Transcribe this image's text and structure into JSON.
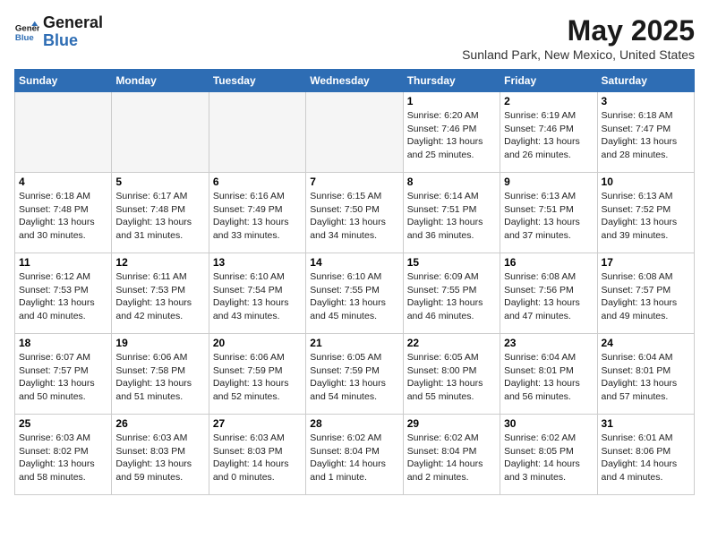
{
  "header": {
    "logo_line1": "General",
    "logo_line2": "Blue",
    "month_title": "May 2025",
    "location": "Sunland Park, New Mexico, United States"
  },
  "weekdays": [
    "Sunday",
    "Monday",
    "Tuesday",
    "Wednesday",
    "Thursday",
    "Friday",
    "Saturday"
  ],
  "weeks": [
    [
      {
        "day": "",
        "info": ""
      },
      {
        "day": "",
        "info": ""
      },
      {
        "day": "",
        "info": ""
      },
      {
        "day": "",
        "info": ""
      },
      {
        "day": "1",
        "info": "Sunrise: 6:20 AM\nSunset: 7:46 PM\nDaylight: 13 hours\nand 25 minutes."
      },
      {
        "day": "2",
        "info": "Sunrise: 6:19 AM\nSunset: 7:46 PM\nDaylight: 13 hours\nand 26 minutes."
      },
      {
        "day": "3",
        "info": "Sunrise: 6:18 AM\nSunset: 7:47 PM\nDaylight: 13 hours\nand 28 minutes."
      }
    ],
    [
      {
        "day": "4",
        "info": "Sunrise: 6:18 AM\nSunset: 7:48 PM\nDaylight: 13 hours\nand 30 minutes."
      },
      {
        "day": "5",
        "info": "Sunrise: 6:17 AM\nSunset: 7:48 PM\nDaylight: 13 hours\nand 31 minutes."
      },
      {
        "day": "6",
        "info": "Sunrise: 6:16 AM\nSunset: 7:49 PM\nDaylight: 13 hours\nand 33 minutes."
      },
      {
        "day": "7",
        "info": "Sunrise: 6:15 AM\nSunset: 7:50 PM\nDaylight: 13 hours\nand 34 minutes."
      },
      {
        "day": "8",
        "info": "Sunrise: 6:14 AM\nSunset: 7:51 PM\nDaylight: 13 hours\nand 36 minutes."
      },
      {
        "day": "9",
        "info": "Sunrise: 6:13 AM\nSunset: 7:51 PM\nDaylight: 13 hours\nand 37 minutes."
      },
      {
        "day": "10",
        "info": "Sunrise: 6:13 AM\nSunset: 7:52 PM\nDaylight: 13 hours\nand 39 minutes."
      }
    ],
    [
      {
        "day": "11",
        "info": "Sunrise: 6:12 AM\nSunset: 7:53 PM\nDaylight: 13 hours\nand 40 minutes."
      },
      {
        "day": "12",
        "info": "Sunrise: 6:11 AM\nSunset: 7:53 PM\nDaylight: 13 hours\nand 42 minutes."
      },
      {
        "day": "13",
        "info": "Sunrise: 6:10 AM\nSunset: 7:54 PM\nDaylight: 13 hours\nand 43 minutes."
      },
      {
        "day": "14",
        "info": "Sunrise: 6:10 AM\nSunset: 7:55 PM\nDaylight: 13 hours\nand 45 minutes."
      },
      {
        "day": "15",
        "info": "Sunrise: 6:09 AM\nSunset: 7:55 PM\nDaylight: 13 hours\nand 46 minutes."
      },
      {
        "day": "16",
        "info": "Sunrise: 6:08 AM\nSunset: 7:56 PM\nDaylight: 13 hours\nand 47 minutes."
      },
      {
        "day": "17",
        "info": "Sunrise: 6:08 AM\nSunset: 7:57 PM\nDaylight: 13 hours\nand 49 minutes."
      }
    ],
    [
      {
        "day": "18",
        "info": "Sunrise: 6:07 AM\nSunset: 7:57 PM\nDaylight: 13 hours\nand 50 minutes."
      },
      {
        "day": "19",
        "info": "Sunrise: 6:06 AM\nSunset: 7:58 PM\nDaylight: 13 hours\nand 51 minutes."
      },
      {
        "day": "20",
        "info": "Sunrise: 6:06 AM\nSunset: 7:59 PM\nDaylight: 13 hours\nand 52 minutes."
      },
      {
        "day": "21",
        "info": "Sunrise: 6:05 AM\nSunset: 7:59 PM\nDaylight: 13 hours\nand 54 minutes."
      },
      {
        "day": "22",
        "info": "Sunrise: 6:05 AM\nSunset: 8:00 PM\nDaylight: 13 hours\nand 55 minutes."
      },
      {
        "day": "23",
        "info": "Sunrise: 6:04 AM\nSunset: 8:01 PM\nDaylight: 13 hours\nand 56 minutes."
      },
      {
        "day": "24",
        "info": "Sunrise: 6:04 AM\nSunset: 8:01 PM\nDaylight: 13 hours\nand 57 minutes."
      }
    ],
    [
      {
        "day": "25",
        "info": "Sunrise: 6:03 AM\nSunset: 8:02 PM\nDaylight: 13 hours\nand 58 minutes."
      },
      {
        "day": "26",
        "info": "Sunrise: 6:03 AM\nSunset: 8:03 PM\nDaylight: 13 hours\nand 59 minutes."
      },
      {
        "day": "27",
        "info": "Sunrise: 6:03 AM\nSunset: 8:03 PM\nDaylight: 14 hours\nand 0 minutes."
      },
      {
        "day": "28",
        "info": "Sunrise: 6:02 AM\nSunset: 8:04 PM\nDaylight: 14 hours\nand 1 minute."
      },
      {
        "day": "29",
        "info": "Sunrise: 6:02 AM\nSunset: 8:04 PM\nDaylight: 14 hours\nand 2 minutes."
      },
      {
        "day": "30",
        "info": "Sunrise: 6:02 AM\nSunset: 8:05 PM\nDaylight: 14 hours\nand 3 minutes."
      },
      {
        "day": "31",
        "info": "Sunrise: 6:01 AM\nSunset: 8:06 PM\nDaylight: 14 hours\nand 4 minutes."
      }
    ]
  ]
}
